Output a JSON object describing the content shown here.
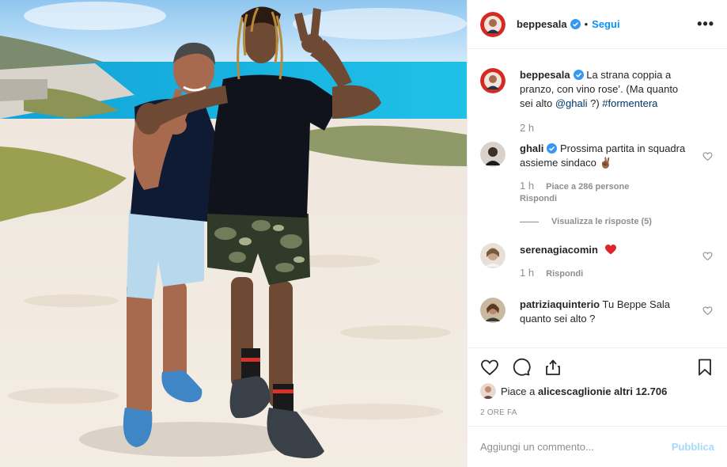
{
  "post": {
    "author": "beppesala",
    "follow_label": "Segui",
    "more_label": "•••"
  },
  "comments": [
    {
      "user": "beppesala",
      "text_prefix": "La strana coppia a pranzo, con vino rose’. (Ma quanto sei alto ",
      "mention": "@ghali",
      "text_mid": " ?) ",
      "hashtag": "#formentera",
      "time": "2 h"
    },
    {
      "user": "ghali",
      "text": "Prossima partita in squadra assieme sindaco ✌🏾",
      "time": "1 h",
      "likes": "Piace a 286 persone",
      "reply": "Rispondi",
      "view_replies": "Visualizza le risposte (5)"
    },
    {
      "user": "serenagiacomin",
      "text": "",
      "time": "1 h",
      "reply": "Rispondi"
    },
    {
      "user": "patriziaquinterio",
      "text": "Tu Beppe Sala quanto sei alto ?"
    }
  ],
  "likes": {
    "prefix": "Piace a ",
    "user": "alicescaglioni",
    "suffix": " e altri 12.706"
  },
  "timestamp": "2 ORE FA",
  "comment_box": {
    "placeholder": "Aggiungi un commento...",
    "publish_label": "Pubblica"
  },
  "colors": {
    "accent": "#0095f6",
    "verified": "#3897f0",
    "heart": "#ed4956"
  },
  "icons": [
    "heart-icon",
    "comment-icon",
    "share-icon",
    "bookmark-icon",
    "verified-icon",
    "more-icon"
  ]
}
